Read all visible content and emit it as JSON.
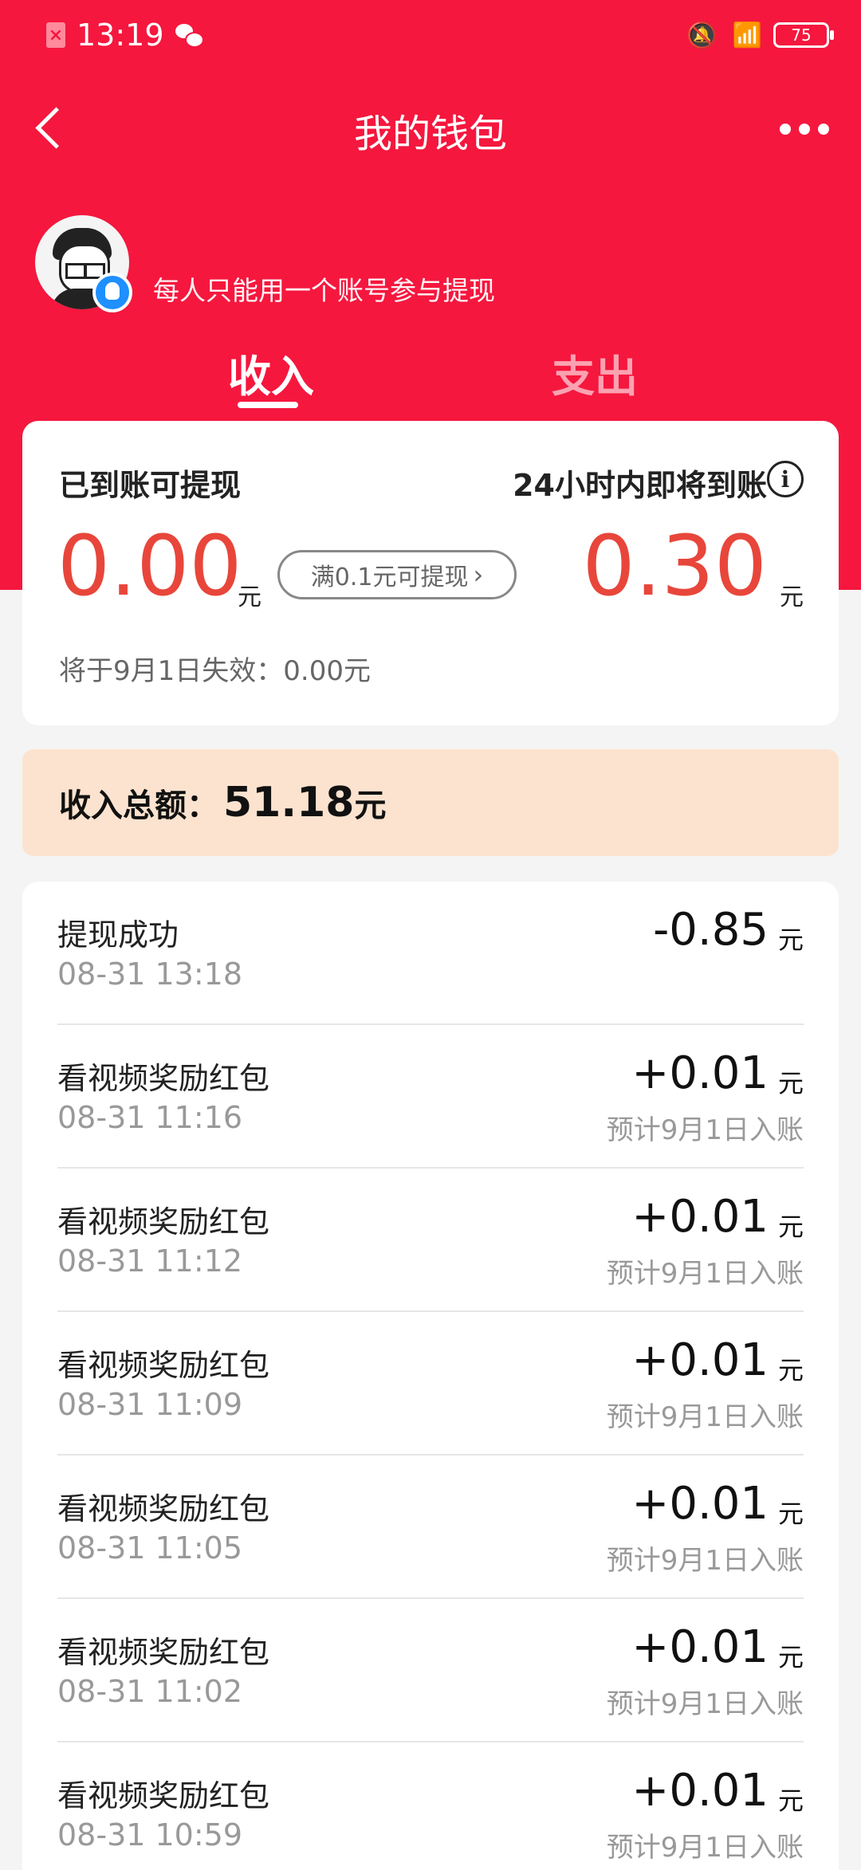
{
  "status_bar": {
    "time": "13:19",
    "battery": "75",
    "sim_mark": "×"
  },
  "header": {
    "title": "我的钱包"
  },
  "profile": {
    "notice": "每人只能用一个账号参与提现"
  },
  "tabs": [
    {
      "label": "收入",
      "active": true
    },
    {
      "label": "支出",
      "active": false
    }
  ],
  "balance": {
    "available_label": "已到账可提现",
    "available_amount": "0.00",
    "unit": "元",
    "withdraw_button": "满0.1元可提现",
    "pending_label": "24小时内即将到账",
    "pending_amount": "0.30",
    "expire_note": "将于9月1日失效：0.00元"
  },
  "summary": {
    "label": "收入总额：",
    "amount": "51.18",
    "unit": "元"
  },
  "transactions": [
    {
      "name": "提现成功",
      "time": "08-31 13:18",
      "amount": "-0.85",
      "unit": "元",
      "note": ""
    },
    {
      "name": "看视频奖励红包",
      "time": "08-31 11:16",
      "amount": "+0.01",
      "unit": "元",
      "note": "预计9月1日入账"
    },
    {
      "name": "看视频奖励红包",
      "time": "08-31 11:12",
      "amount": "+0.01",
      "unit": "元",
      "note": "预计9月1日入账"
    },
    {
      "name": "看视频奖励红包",
      "time": "08-31 11:09",
      "amount": "+0.01",
      "unit": "元",
      "note": "预计9月1日入账"
    },
    {
      "name": "看视频奖励红包",
      "time": "08-31 11:05",
      "amount": "+0.01",
      "unit": "元",
      "note": "预计9月1日入账"
    },
    {
      "name": "看视频奖励红包",
      "time": "08-31 11:02",
      "amount": "+0.01",
      "unit": "元",
      "note": "预计9月1日入账"
    },
    {
      "name": "看视频奖励红包",
      "time": "08-31 10:59",
      "amount": "+0.01",
      "unit": "元",
      "note": "预计9月1日入账"
    }
  ],
  "colors": {
    "brand_red": "#f5173e",
    "amount_red": "#e8463b",
    "summary_bg": "#fce3cf"
  }
}
